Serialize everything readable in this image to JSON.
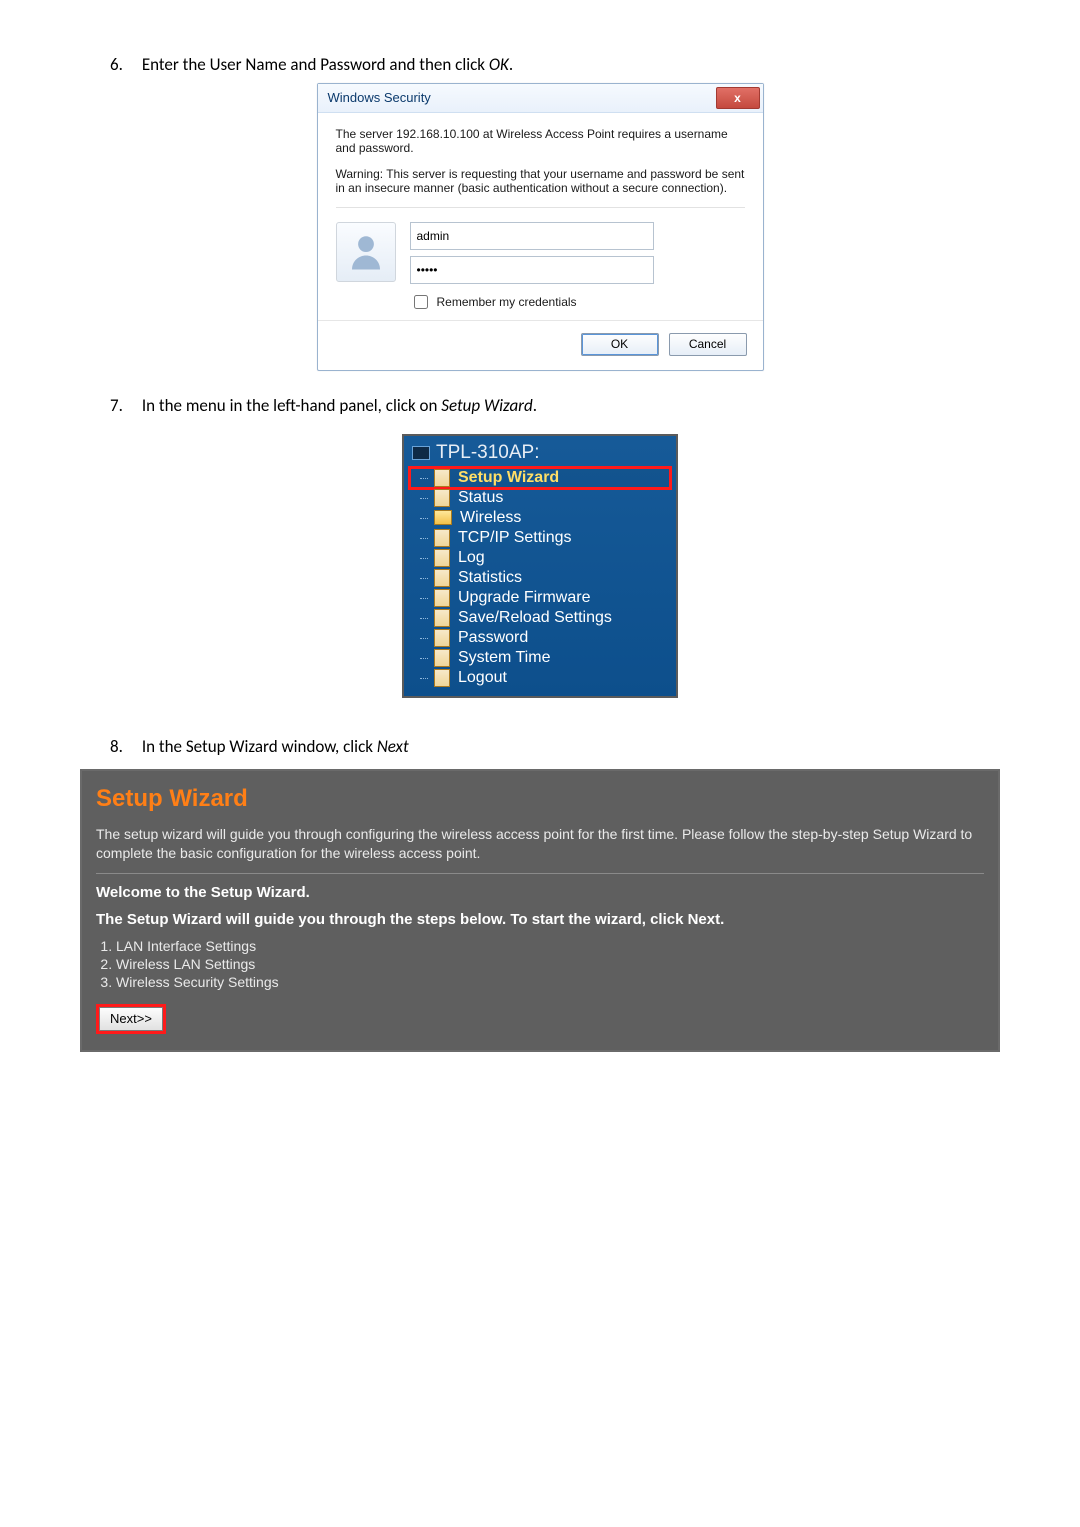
{
  "steps": {
    "6": "Enter the User Name and Password and then click",
    "6_em": "OK",
    "7": "In the menu in the left-hand panel, click on",
    "7_em": "Setup Wizard",
    "8": "In the Setup Wizard window, click",
    "8_em": "Next"
  },
  "dialog": {
    "title": "Windows Security",
    "close": "x",
    "msg1": "The server 192.168.10.100 at Wireless Access Point requires a username and password.",
    "msg2": "Warning: This server is requesting that your username and password be sent in an insecure manner (basic authentication without a secure connection).",
    "username_value": "admin",
    "password_value": "•••••",
    "remember_label": "Remember my credentials",
    "ok": "OK",
    "cancel": "Cancel"
  },
  "tree": {
    "root": "TPL-310AP:",
    "items": [
      {
        "label": "Setup Wizard",
        "type": "file",
        "highlight": true
      },
      {
        "label": "Status",
        "type": "file",
        "highlight": false
      },
      {
        "label": "Wireless",
        "type": "folder",
        "highlight": false
      },
      {
        "label": "TCP/IP Settings",
        "type": "file",
        "highlight": false
      },
      {
        "label": "Log",
        "type": "file",
        "highlight": false
      },
      {
        "label": "Statistics",
        "type": "file",
        "highlight": false
      },
      {
        "label": "Upgrade Firmware",
        "type": "file",
        "highlight": false
      },
      {
        "label": "Save/Reload Settings",
        "type": "file",
        "highlight": false
      },
      {
        "label": "Password",
        "type": "file",
        "highlight": false
      },
      {
        "label": "System Time",
        "type": "file",
        "highlight": false
      },
      {
        "label": "Logout",
        "type": "file",
        "highlight": false
      }
    ]
  },
  "wizard": {
    "heading": "Setup Wizard",
    "desc": "The setup wizard will guide you through configuring the wireless access point for the first time. Please follow the step-by-step Setup Wizard to complete the basic configuration for the wireless access point.",
    "welcome": "Welcome to the Setup Wizard.",
    "guide": "The Setup Wizard will guide you through the steps below. To start the wizard, click Next.",
    "steps": [
      "LAN Interface Settings",
      "Wireless LAN Settings",
      "Wireless Security Settings"
    ],
    "next": "Next>>"
  }
}
